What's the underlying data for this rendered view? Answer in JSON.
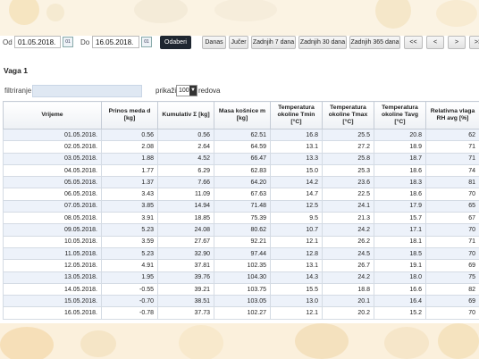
{
  "filters": {
    "from_label": "Od",
    "from_value": "01.05.2018.",
    "to_label": "Do",
    "to_value": "16.05.2018.",
    "calendar_icon_text": "01",
    "submit_label": "Odaberi"
  },
  "quick_buttons": {
    "today": "Danas",
    "yesterday": "Jučer",
    "last7": "Zadnjih 7 dana",
    "last30": "Zadnjih 30 dana",
    "last365": "Zadnjih 365 dana",
    "first": "<<",
    "prev": "<",
    "next": ">",
    "last": ">>"
  },
  "section_title": "Vaga 1",
  "table_controls": {
    "filter_label": "filtriranje",
    "filter_value": "",
    "show_label": "prikaži",
    "show_value": "100",
    "rows_label": "redova"
  },
  "table": {
    "headers": [
      "Vrijeme",
      "Prinos meda d [kg]",
      "Kumulativ Σ [kg]",
      "Masa košnice m [kg]",
      "Temperatura okoline Tmin [°C]",
      "Temperatura okoline Tmax [°C]",
      "Temperatura okoline Tavg [°C]",
      "Relativna vlaga RH avg [%]"
    ],
    "rows": [
      [
        "01.05.2018.",
        "0.56",
        "0.56",
        "62.51",
        "16.8",
        "25.5",
        "20.8",
        "62"
      ],
      [
        "02.05.2018.",
        "2.08",
        "2.64",
        "64.59",
        "13.1",
        "27.2",
        "18.9",
        "71"
      ],
      [
        "03.05.2018.",
        "1.88",
        "4.52",
        "66.47",
        "13.3",
        "25.8",
        "18.7",
        "71"
      ],
      [
        "04.05.2018.",
        "1.77",
        "6.29",
        "62.83",
        "15.0",
        "25.3",
        "18.6",
        "74"
      ],
      [
        "05.05.2018.",
        "1.37",
        "7.66",
        "64.20",
        "14.2",
        "23.6",
        "18.3",
        "81"
      ],
      [
        "06.05.2018.",
        "3.43",
        "11.09",
        "67.63",
        "14.7",
        "22.5",
        "18.6",
        "70"
      ],
      [
        "07.05.2018.",
        "3.85",
        "14.94",
        "71.48",
        "12.5",
        "24.1",
        "17.9",
        "65"
      ],
      [
        "08.05.2018.",
        "3.91",
        "18.85",
        "75.39",
        "9.5",
        "21.3",
        "15.7",
        "67"
      ],
      [
        "09.05.2018.",
        "5.23",
        "24.08",
        "80.62",
        "10.7",
        "24.2",
        "17.1",
        "70"
      ],
      [
        "10.05.2018.",
        "3.59",
        "27.67",
        "92.21",
        "12.1",
        "26.2",
        "18.1",
        "71"
      ],
      [
        "11.05.2018.",
        "5.23",
        "32.90",
        "97.44",
        "12.8",
        "24.5",
        "18.5",
        "70"
      ],
      [
        "12.05.2018.",
        "4.91",
        "37.81",
        "102.35",
        "13.1",
        "26.7",
        "19.1",
        "69"
      ],
      [
        "13.05.2018.",
        "1.95",
        "39.76",
        "104.30",
        "14.3",
        "24.2",
        "18.0",
        "75"
      ],
      [
        "14.05.2018.",
        "-0.55",
        "39.21",
        "103.75",
        "15.5",
        "18.8",
        "16.6",
        "82"
      ],
      [
        "15.05.2018.",
        "-0.70",
        "38.51",
        "103.05",
        "13.0",
        "20.1",
        "16.4",
        "69"
      ],
      [
        "16.05.2018.",
        "-0.78",
        "37.73",
        "102.27",
        "12.1",
        "20.2",
        "15.2",
        "70"
      ]
    ]
  },
  "colors": {
    "banner": "#fbf3e3",
    "row_alt": "#edf2fa",
    "primary_button": "#1e2630"
  }
}
